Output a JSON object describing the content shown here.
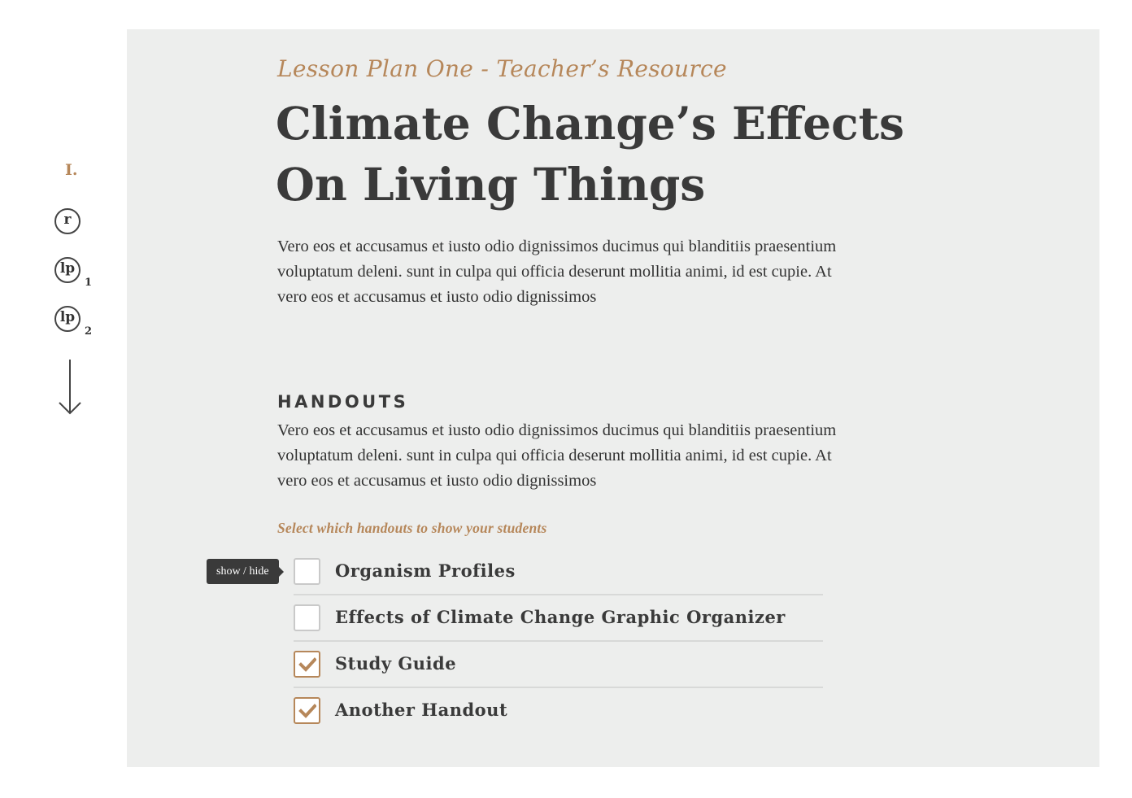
{
  "rail": {
    "numeral": "I.",
    "items": [
      {
        "label": "r",
        "sub": ""
      },
      {
        "label": "lp",
        "sub": "1"
      },
      {
        "label": "lp",
        "sub": "2"
      }
    ],
    "scroll_icon": "arrow-down-icon"
  },
  "header": {
    "kicker": "Lesson Plan One - Teacher’s Resource",
    "title": "Climate Change’s Effects On Living Things"
  },
  "intro": "Vero eos et accusamus et iusto odio dignissimos ducimus qui blanditiis praesentium voluptatum deleni. sunt in culpa qui officia deserunt mollitia animi, id est cupie. At vero eos et accusamus et iusto odio dignissimos",
  "handouts": {
    "heading": "HANDOUTS",
    "body": "Vero eos et accusamus et iusto odio dignissimos ducimus qui blanditiis praesentium voluptatum deleni. sunt in culpa qui officia deserunt mollitia animi, id est cupie. At vero eos et accusamus et iusto odio dignissimos",
    "instruction": "Select which handouts to show your students",
    "tooltip": "show / hide",
    "items": [
      {
        "label": "Organism Profiles",
        "checked": false
      },
      {
        "label": "Effects of Climate Change Graphic Organizer",
        "checked": false
      },
      {
        "label": "Study Guide",
        "checked": true
      },
      {
        "label": "Another Handout",
        "checked": true
      }
    ]
  },
  "colors": {
    "accent": "#b6875a",
    "panel": "#edeeed",
    "text": "#3a3a3a",
    "tooltip_bg": "#3a3a3a"
  }
}
